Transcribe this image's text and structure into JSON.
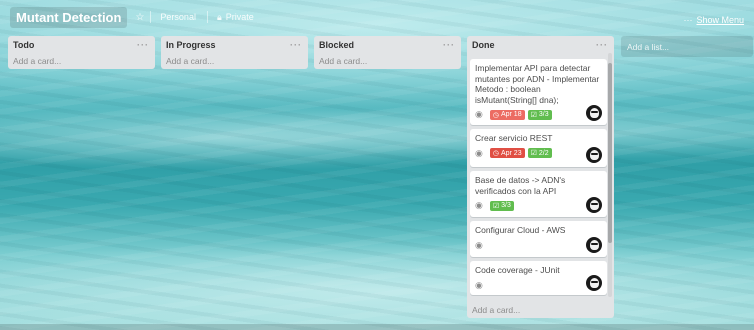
{
  "header": {
    "board_title": "Mutant Detection",
    "personal_label": "Personal",
    "private_label": "Private",
    "menu_prefix": "···",
    "show_menu_label": "Show Menu"
  },
  "icons": {
    "star": "star-icon",
    "lock": "lock-icon",
    "eye": "eye-icon",
    "clock": "clock-icon",
    "checklist": "checklist-icon"
  },
  "colors": {
    "due_badge": "#ec6c63",
    "check_badge": "#61bd4f",
    "list_bg": "#e2e4e6"
  },
  "lists": [
    {
      "title": "Todo",
      "menu": "···",
      "add_card": "Add a card..."
    },
    {
      "title": "In Progress",
      "menu": "···",
      "add_card": "Add a card..."
    },
    {
      "title": "Blocked",
      "menu": "···",
      "add_card": "Add a card..."
    },
    {
      "title": "Done",
      "menu": "···",
      "add_card": "Add a card...",
      "cards": [
        {
          "title": "Implementar API para detectar mutantes por ADN - Implementar Metodo : boolean isMutant(String[] dna);",
          "due": "Apr 18",
          "checklist": "3/3"
        },
        {
          "title": "Crear servicio REST",
          "due": "Apr 23",
          "checklist": "2/2"
        },
        {
          "title": "Base de datos -> ADN's verificados con la API",
          "checklist": "3/3"
        },
        {
          "title": "Configurar Cloud - AWS"
        },
        {
          "title": "Code coverage - JUnit"
        }
      ]
    }
  ],
  "add_list_label": "Add a list..."
}
